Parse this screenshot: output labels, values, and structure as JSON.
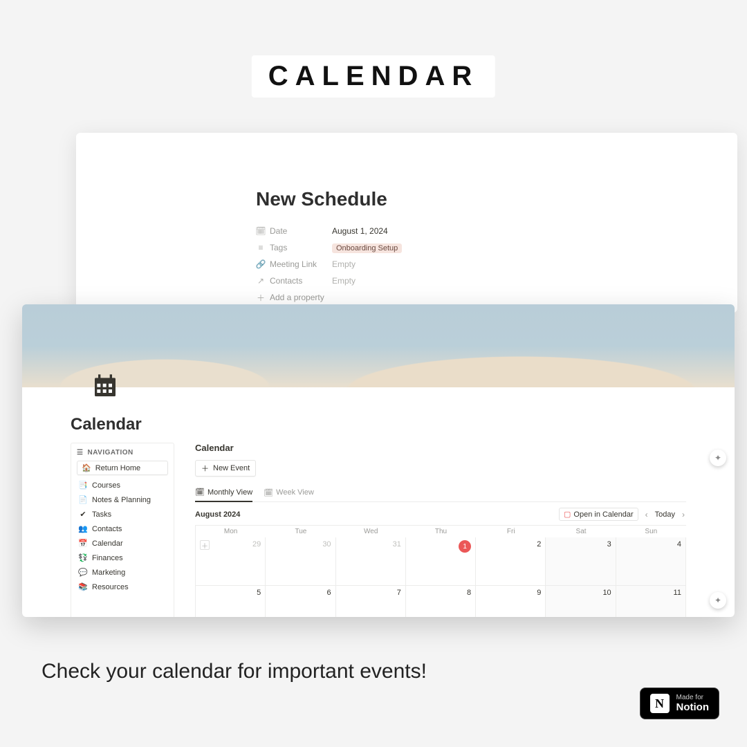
{
  "banner": "CALENDAR",
  "caption": "Check your calendar for important events!",
  "badge": {
    "prefix": "Made for",
    "brand": "Notion",
    "logo_letter": "N"
  },
  "back_card": {
    "title": "New Schedule",
    "props": [
      {
        "icon": "calendar-icon",
        "label": "Date",
        "value": "August 1, 2024",
        "type": "text"
      },
      {
        "icon": "list-icon",
        "label": "Tags",
        "value": "Onboarding Setup",
        "type": "tag"
      },
      {
        "icon": "link-icon",
        "label": "Meeting Link",
        "value": "Empty",
        "type": "empty"
      },
      {
        "icon": "arrow-icon",
        "label": "Contacts",
        "value": "Empty",
        "type": "empty"
      },
      {
        "icon": "plus-icon",
        "label": "Add a property",
        "value": "",
        "type": "action"
      }
    ]
  },
  "front_card": {
    "title": "Calendar",
    "nav": {
      "header": "NAVIGATION",
      "return": "Return Home",
      "items": [
        {
          "icon": "📑",
          "label": "Courses"
        },
        {
          "icon": "📄",
          "label": "Notes & Planning"
        },
        {
          "icon": "✔",
          "label": "Tasks"
        },
        {
          "icon": "👥",
          "label": "Contacts"
        },
        {
          "icon": "📅",
          "label": "Calendar"
        },
        {
          "icon": "💱",
          "label": "Finances"
        },
        {
          "icon": "💬",
          "label": "Marketing"
        },
        {
          "icon": "📚",
          "label": "Resources"
        }
      ]
    },
    "section": "Calendar",
    "new_event": "New Event",
    "tabs": [
      {
        "label": "Monthly View",
        "active": true
      },
      {
        "label": "Week View",
        "active": false
      }
    ],
    "toolbar": {
      "month": "August 2024",
      "open": "Open in Calendar",
      "today": "Today"
    },
    "weekdays": [
      "Mon",
      "Tue",
      "Wed",
      "Thu",
      "Fri",
      "Sat",
      "Sun"
    ],
    "rows": [
      [
        {
          "n": "29",
          "other": true,
          "add": true
        },
        {
          "n": "30",
          "other": true
        },
        {
          "n": "31",
          "other": true
        },
        {
          "n": "1",
          "today": true
        },
        {
          "n": "2"
        },
        {
          "n": "3",
          "weekend": true
        },
        {
          "n": "4",
          "weekend": true
        }
      ],
      [
        {
          "n": "5"
        },
        {
          "n": "6"
        },
        {
          "n": "7"
        },
        {
          "n": "8"
        },
        {
          "n": "9"
        },
        {
          "n": "10",
          "weekend": true
        },
        {
          "n": "11",
          "weekend": true
        }
      ]
    ]
  }
}
